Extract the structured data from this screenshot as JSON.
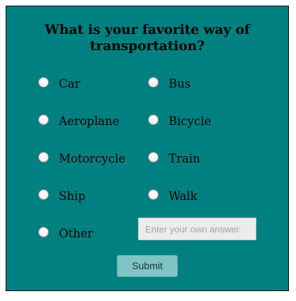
{
  "form": {
    "title_line1": "What is your favorite way of",
    "title_line2": "transportation?",
    "options": {
      "car": "Car",
      "bus": "Bus",
      "aeroplane": "Aeroplane",
      "bicycle": "Bicycle",
      "motorcycle": "Motorcycle",
      "train": "Train",
      "ship": "Ship",
      "walk": "Walk",
      "other": "Other"
    },
    "other_input": {
      "value": "",
      "placeholder": "Enter your own answer."
    },
    "submit_label": "Submit"
  },
  "colors": {
    "card_background": "#008080",
    "submit_background": "#7fc5c5",
    "input_background": "#ececec"
  }
}
